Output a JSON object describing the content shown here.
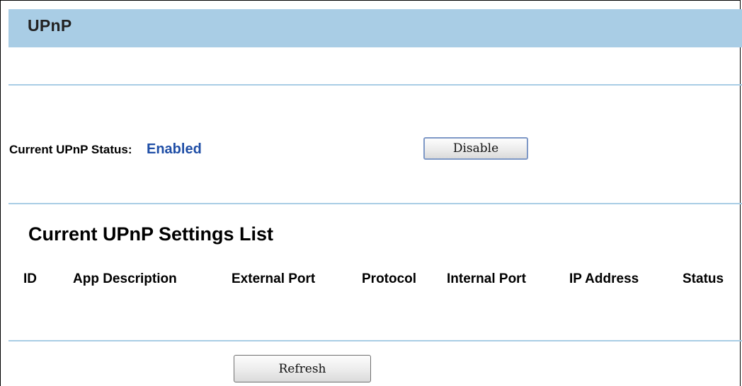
{
  "header": {
    "title": "UPnP"
  },
  "status": {
    "label": "Current UPnP Status:",
    "value": "Enabled",
    "value_color": "#1f4ea6",
    "toggle_button_label": "Disable"
  },
  "settings_list": {
    "title": "Current UPnP Settings List",
    "columns": [
      "ID",
      "App Description",
      "External Port",
      "Protocol",
      "Internal Port",
      "IP Address",
      "Status"
    ],
    "rows": []
  },
  "actions": {
    "refresh_label": "Refresh"
  },
  "colors": {
    "accent": "#a9cde5"
  }
}
